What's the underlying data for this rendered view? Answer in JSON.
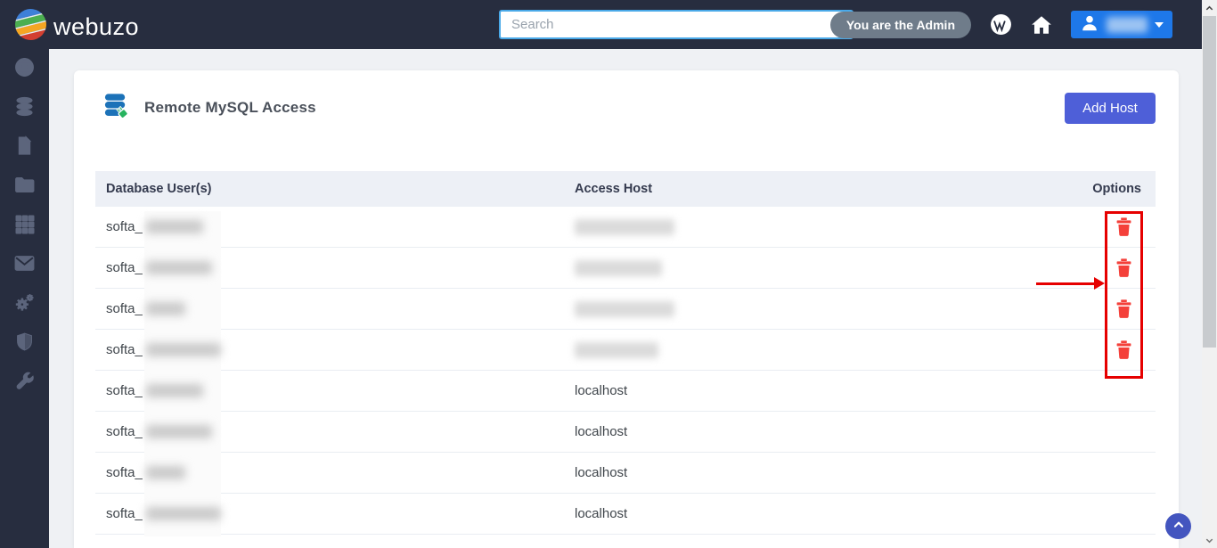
{
  "colors": {
    "navbar-bg": "#272d3f",
    "sidebar-icon": "#5c657c",
    "page-bg": "#eff1f4",
    "card-bg": "#ffffff",
    "table-header-bg": "#edf0f6",
    "text-dark": "#343a4e",
    "row-text": "#3f454b",
    "divider": "#e9edf2",
    "accent-blue": "#4e5fd8",
    "user-btn-blue": "#1e78e9",
    "search-border": "#4aa9e8",
    "admin-pill-bg": "#6f7c8a",
    "trash-red": "#f4403a",
    "annotation-red": "#e60000",
    "scrolltop-bg": "#4355bf"
  },
  "navbar": {
    "logo_text": "webuzo",
    "search": {
      "placeholder": "Search",
      "value": ""
    },
    "admin_badge": "You are the Admin"
  },
  "sidebar": {
    "items": [
      {
        "icon": "globe-icon"
      },
      {
        "icon": "database-icon"
      },
      {
        "icon": "file-icon"
      },
      {
        "icon": "folder-icon"
      },
      {
        "icon": "grid-icon"
      },
      {
        "icon": "mail-icon"
      },
      {
        "icon": "gears-icon"
      },
      {
        "icon": "shield-icon"
      },
      {
        "icon": "wrench-icon"
      }
    ]
  },
  "page": {
    "title": "Remote MySQL Access",
    "add_host_label": "Add Host"
  },
  "table": {
    "headers": {
      "user": "Database User(s)",
      "host": "Access Host",
      "options": "Options"
    },
    "rows": [
      {
        "user_prefix": "softa_",
        "user_redacted": true,
        "user_blur": 64,
        "host": null,
        "host_redacted": true,
        "host_blur": 112,
        "deletable": true
      },
      {
        "user_prefix": "softa_",
        "user_redacted": true,
        "user_blur": 74,
        "host": null,
        "host_redacted": true,
        "host_blur": 98,
        "deletable": true
      },
      {
        "user_prefix": "softa_",
        "user_redacted": true,
        "user_blur": 44,
        "host": null,
        "host_redacted": true,
        "host_blur": 112,
        "deletable": true
      },
      {
        "user_prefix": "softa_",
        "user_redacted": true,
        "user_blur": 84,
        "host": null,
        "host_redacted": true,
        "host_blur": 94,
        "deletable": true
      },
      {
        "user_prefix": "softa_",
        "user_redacted": true,
        "user_blur": 64,
        "host": "localhost",
        "host_redacted": false,
        "host_blur": 0,
        "deletable": false
      },
      {
        "user_prefix": "softa_",
        "user_redacted": true,
        "user_blur": 74,
        "host": "localhost",
        "host_redacted": false,
        "host_blur": 0,
        "deletable": false
      },
      {
        "user_prefix": "softa_",
        "user_redacted": true,
        "user_blur": 44,
        "host": "localhost",
        "host_redacted": false,
        "host_blur": 0,
        "deletable": false
      },
      {
        "user_prefix": "softa_",
        "user_redacted": true,
        "user_blur": 84,
        "host": "localhost",
        "host_redacted": false,
        "host_blur": 0,
        "deletable": false
      }
    ]
  }
}
